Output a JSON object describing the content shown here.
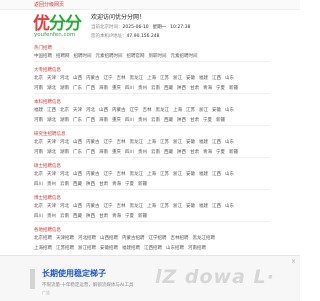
{
  "topbar": {
    "link": "返回分级网页"
  },
  "logo": {
    "part1": "优",
    "part2": "分分",
    "domain": "youfenfen.com"
  },
  "header": {
    "welcome": "欢迎访问优分分网！",
    "date_label": "当前北京时间：",
    "date": "2025-06-10",
    "weekday": "星期一",
    "time": "10:27:38",
    "ip_label": "您的本机IP地址：",
    "ip": "47.90.156.248"
  },
  "sections": [
    {
      "title": "热门招聘",
      "rows": [
        [
          "中国招聘",
          "招聘网",
          "招聘时间",
          "元素招聘时间",
          "招聘官网",
          "到职时间",
          "元素招聘时间"
        ]
      ]
    },
    {
      "title": "大专招聘信息",
      "rows": [
        [
          "北京",
          "天津",
          "河北",
          "山西",
          "内蒙古",
          "辽宁",
          "吉林",
          "黑龙江",
          "上海",
          "江苏",
          "浙江",
          "安徽",
          "福建",
          "江西",
          "山东"
        ],
        [
          "河南",
          "湖北",
          "湖南",
          "广东",
          "广西",
          "海南",
          "重庆",
          "四川",
          "贵州",
          "云南",
          "西藏",
          "陕西",
          "甘肃",
          "青海",
          "宁夏",
          "新疆"
        ]
      ]
    },
    {
      "title": "本科招聘信息",
      "rows": [
        [
          "福建",
          "江西",
          "北京",
          "天津",
          "河北",
          "山西",
          "内蒙古",
          "辽宁",
          "吉林",
          "黑龙江",
          "上海",
          "江苏",
          "浙江",
          "安徽",
          "山东"
        ],
        [
          "河南",
          "湖北",
          "湖南",
          "广东",
          "广西",
          "海南",
          "重庆",
          "四川",
          "贵州",
          "云南",
          "西藏",
          "陕西",
          "甘肃",
          "宁夏",
          "新疆"
        ]
      ]
    },
    {
      "title": "研究生招聘信息",
      "rows": [
        [
          "北京",
          "天津",
          "河北",
          "山西",
          "内蒙古",
          "辽宁",
          "吉林",
          "黑龙江",
          "上海",
          "江苏",
          "浙江",
          "安徽",
          "福建",
          "江西",
          "山东"
        ],
        [
          "河南",
          "湖北",
          "湖南",
          "广东",
          "广西",
          "海南",
          "重庆",
          "四川",
          "贵州",
          "云南",
          "西藏",
          "陕西",
          "甘肃",
          "青海",
          "宁夏",
          "新疆"
        ]
      ]
    },
    {
      "title": "硕士招聘信息",
      "rows": [
        [
          "北京",
          "天津",
          "河北",
          "山西",
          "内蒙古",
          "辽宁",
          "吉林",
          "黑龙江",
          "上海",
          "江苏",
          "浙江",
          "安徽",
          "福建",
          "江西",
          "山东"
        ],
        [
          "四川",
          "贵州",
          "云南",
          "西藏",
          "陕西",
          "甘肃",
          "青海",
          "宁夏",
          "新疆"
        ]
      ]
    },
    {
      "title": "博士招聘信息",
      "rows": [
        [
          "北京",
          "天津",
          "河北",
          "山西",
          "内蒙古",
          "辽宁",
          "吉林",
          "黑龙江",
          "上海",
          "江苏",
          "浙江",
          "安徽",
          "福建",
          "江西",
          "山东"
        ],
        [
          "四川",
          "贵州",
          "云南",
          "西藏",
          "陕西",
          "甘肃",
          "青海",
          "宁夏",
          "新疆"
        ]
      ]
    },
    {
      "title": "各地招聘信息",
      "rows": [
        [
          "北京招聘",
          "天津招聘",
          "河北招聘",
          "山西招聘",
          "内蒙古招聘",
          "辽宁招聘",
          "吉林招聘",
          "黑龙江招聘"
        ],
        [
          "上海招聘",
          "江苏招聘",
          "浙江招聘",
          "安徽招聘",
          "福建招聘",
          "江西招聘",
          "山东招聘",
          "河南招聘"
        ],
        [
          "湖北招聘",
          "湖南招聘",
          "广东招聘",
          "广西招聘",
          "海南招聘",
          "重庆招聘",
          "四川招聘",
          "贵州招聘"
        ],
        [
          "云南招聘",
          "西藏招聘",
          "陕西招聘",
          "甘肃招聘",
          "青海招聘",
          "宁夏招聘",
          "新疆招聘"
        ]
      ]
    }
  ],
  "ad": {
    "slogan": "长期使用稳定梯子",
    "sub": "不限流量·十年稳定运营，解锁流媒体与AI工具",
    "tag": "广告",
    "wordmark": "lZ dowa L·",
    "close": "×"
  }
}
